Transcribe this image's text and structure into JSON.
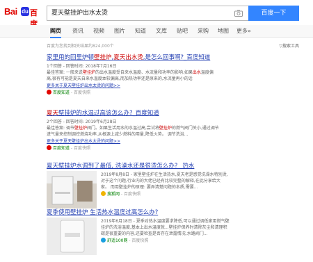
{
  "header": {
    "logo_left": "Bai",
    "logo_paw": "du",
    "logo_right": "百度",
    "query": "夏天壁挂炉出水太烫",
    "search_button": "百度一下"
  },
  "tabs": [
    "网页",
    "资讯",
    "视频",
    "图片",
    "知道",
    "文库",
    "贴吧",
    "采购",
    "地图",
    "更多»"
  ],
  "stats": {
    "text": "百度为您找到相关结果约824,000个",
    "tools": "搜索工具"
  },
  "results": [
    {
      "title_parts": [
        "家里用的回里炉顿",
        "壁挂炉",
        ",",
        "夏天",
        "出水",
        "烫",
        ",是怎么回事啊?_百度知道"
      ],
      "meta": "1个回答 - 回答时间: 2018年7月16日",
      "line1_parts": [
        "最佳答案: 一般来说",
        "壁挂炉",
        "的出水温度受自来水温度、水流量和功率的影响.如果",
        "出水",
        "温度偏"
      ],
      "line2": "高,很有可能是夏天自来水温度本较偏高,而加热功率还是原来的,水流量再小的话",
      "line3": "更多关于夏天壁挂炉出水太烫的问题>>",
      "source": "百度知道",
      "source_extra": " - 百度快照"
    },
    {
      "title_parts": [
        "夏天",
        "壁挂炉",
        "的水温过高该怎么办?_百度知道"
      ],
      "meta": "2个回答 - 回答时间: 2019年6月28日",
      "line1_parts": [
        "最佳答案: 调节",
        "壁挂炉",
        "阀门。如果生活用水的水温过高,尝试将",
        "壁挂炉",
        "的燃气阀门关小,通过调节"
      ],
      "line2": "进气量来控制调控燃烧功率,从根源上减少燃料的用量,降低火势。 调节洗浴...",
      "line3": "更多关于夏天壁挂炉出水太烫的问题>>",
      "source": "百度知道",
      "source_extra": " - 百度快照"
    },
    {
      "title": "夏天壁挂炉水调到了最低, 洗澡水还是很烫怎么办? _热水",
      "line1": "2019年8月8日 - 家里壁挂炉在生活热水,夏天老是感觉洗澡水特别烫,",
      "line2": "对于这个问题,行业内的大佬已经有比较完整的解释,在此分享给大",
      "line3": "家。 而用壁挂炉的原理: 要弄清楚问题的本质,需要...",
      "source": "搜狐网",
      "source_extra": " - 百度快照"
    },
    {
      "title": "夏季使用壁挂炉 生活热水温度过高怎么办?",
      "line1": "2019年6月18日 - 夏季对热水温度要求降低,可以通过调低家用燃气壁",
      "line2": "挂炉的洗浴温度,基本上出水温度就...壁挂炉保养时清除灰尘和清理积",
      "line3": "碳是很重要的内容,还要检查是否存在泄露情况,水路阀门...",
      "source": "舒适100网",
      "source_extra": " - 百度快照"
    }
  ],
  "colors": {
    "link": "#2440b3",
    "highlight": "#cc0000",
    "source": "#008000",
    "brand_blue": "#3385ff",
    "logo_red": "#e10601"
  }
}
